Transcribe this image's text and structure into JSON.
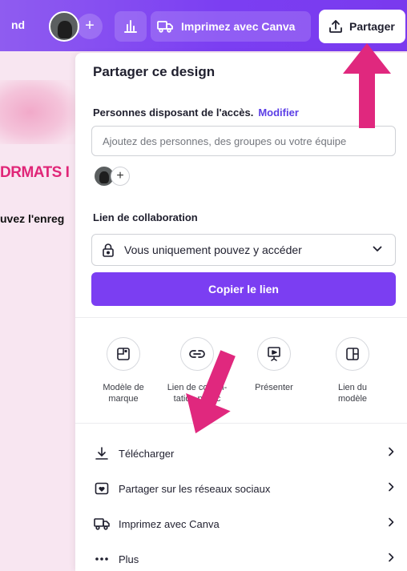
{
  "topbar": {
    "left_text": "nd",
    "plus": "+",
    "print_label": "Imprimez avec Canva",
    "share_label": "Partager",
    "icons": [
      "avatar",
      "plus-icon",
      "chart-icon",
      "truck-icon",
      "share-upload-icon"
    ]
  },
  "canvas": {
    "formats_text": "DRMATS I",
    "save_text": "uvez l'enreg"
  },
  "panel": {
    "title": "Partager ce design",
    "access_label": "Personnes disposant de l'accès.",
    "modify_link": "Modifier",
    "people_input_placeholder": "Ajoutez des personnes, des groupes ou votre équipe",
    "mini_plus": "+",
    "collab_label": "Lien de collaboration",
    "access_select_value": "Vous uniquement pouvez y accéder",
    "copy_link_button": "Copier le lien",
    "tiles": [
      {
        "line1": "Modèle de",
        "line2": "marque",
        "icon": "brand-template-icon"
      },
      {
        "line1": "Lien de consul-",
        "line2": "tation public",
        "icon": "link-icon"
      },
      {
        "line1": "Présenter",
        "line2": "",
        "icon": "present-icon"
      },
      {
        "line1": "Lien du",
        "line2": "modèle",
        "icon": "template-link-icon"
      }
    ],
    "rows": [
      {
        "label": "Télécharger",
        "icon": "download-icon"
      },
      {
        "label": "Partager sur les réseaux sociaux",
        "icon": "social-heart-icon"
      },
      {
        "label": "Imprimez avec Canva",
        "icon": "truck-icon"
      },
      {
        "label": "Plus",
        "icon": "more-icon"
      }
    ]
  },
  "annotations": {
    "arrow_color": "#e0287e"
  },
  "colors": {
    "accent": "#7b3ef2",
    "link": "#5b3ee6",
    "background": "#f8e6f1",
    "canvas_title": "#e02678"
  }
}
